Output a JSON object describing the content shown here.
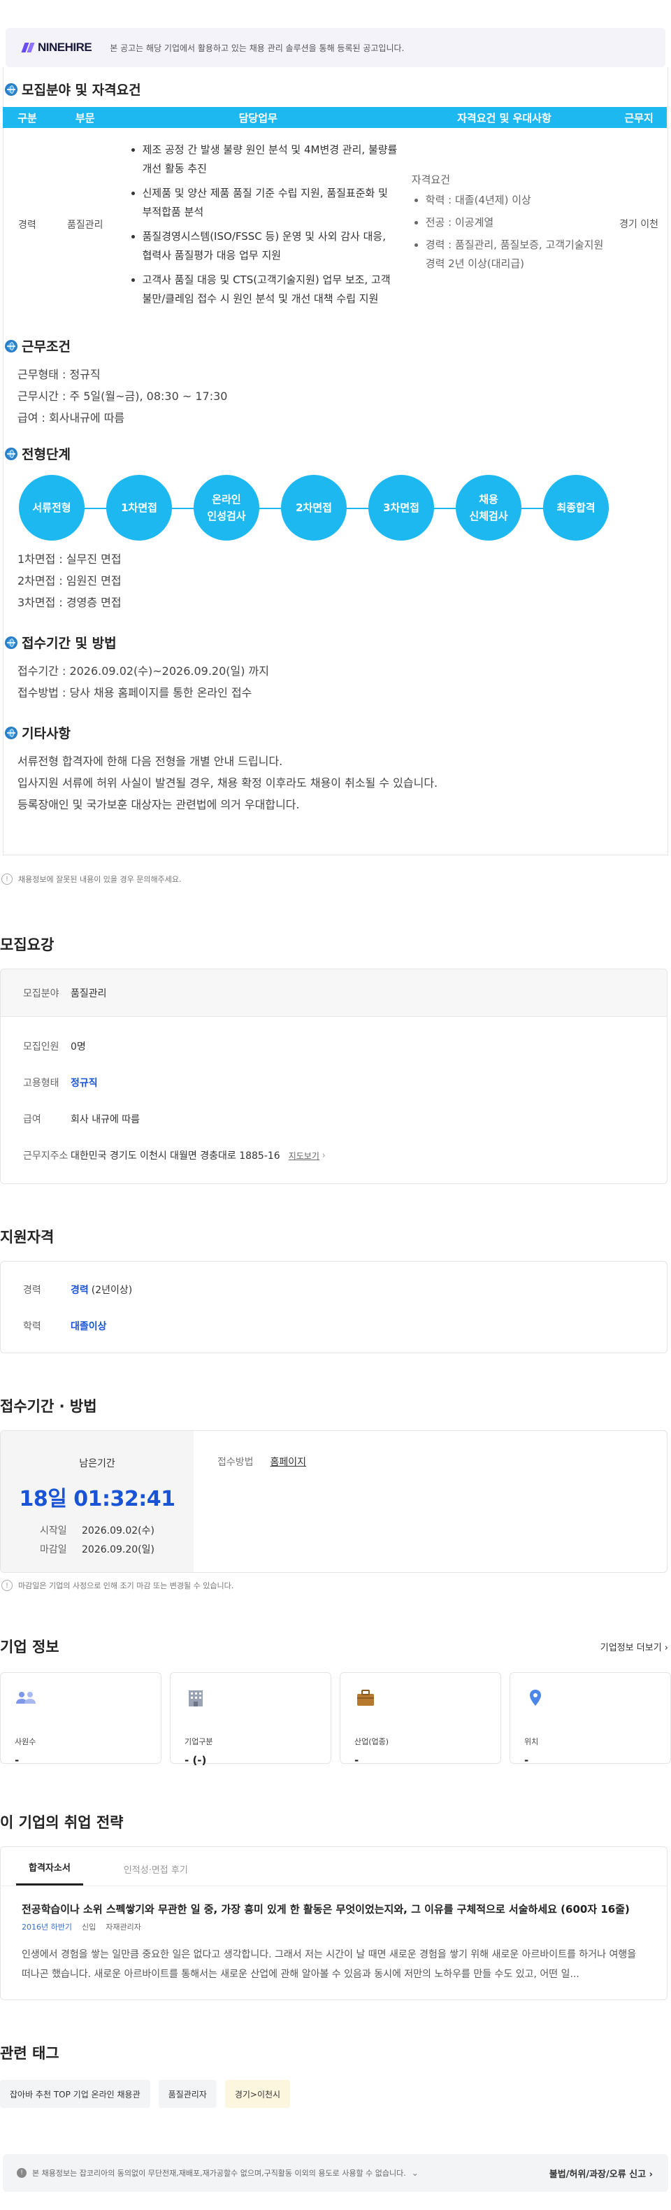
{
  "banner": {
    "logo": "NINEHIRE",
    "text": "본 공고는 해당 기업에서 활용하고 있는 채용 관리 솔루션을 통해 등록된 공고입니다."
  },
  "detail": {
    "field_title": "모집분야 및 자격요건",
    "table": {
      "headers": [
        "구분",
        "부문",
        "담당업무",
        "자격요건 및 우대사항",
        "근무지"
      ],
      "gubun": "경력",
      "bumun": "품질관리",
      "duties": [
        "제조 공정 간 발생 불량 원인 분석 및 4M변경 관리, 불량률 개선 활동 추진",
        "신제품 및 양산 제품 품질 기준 수립 지원, 품질표준화 및 부적합품 분석",
        "품질경영시스템(ISO/FSSC 등) 운영 및 사외 감사 대응, 협력사 품질평가 대응 업무 지원",
        "고객사 품질 대응 및 CTS(고객기술지원) 업무 보조, 고객 불만/클레임 접수 시 원인 분석 및 개선 대책 수립 지원"
      ],
      "qual_heading": "자격요건",
      "quals": [
        "학력 : 대졸(4년제) 이상",
        "전공 : 이공계열",
        "경력 : 품질관리, 품질보증, 고객기술지원 경력 2년 이상(대리급)"
      ],
      "work_place": "경기 이천"
    },
    "cond_title": "근무조건",
    "cond": [
      "근무형태 : 정규직",
      "근무시간 : 주 5일(월~금), 08:30 ~ 17:30",
      "급여 : 회사내규에 따름"
    ],
    "step_title": "전형단계",
    "steps": [
      "서류전형",
      "1차면접",
      "온라인\n인성검사",
      "2차면접",
      "3차면접",
      "채용\n신체검사",
      "최종합격"
    ],
    "step_desc": [
      "1차면접 : 실무진 면접",
      "2차면접 : 임원진 면접",
      "3차면접 : 경영층 면접"
    ],
    "period_title": "접수기간 및 방법",
    "period": [
      "접수기간 : 2026.09.02(수)~2026.09.20(일) 까지",
      "접수방법 : 당사 채용 홈페이지를 통한 온라인 접수"
    ],
    "etc_title": "기타사항",
    "etc": [
      "서류전형 합격자에 한해 다음 전형을 개별 안내 드립니다.",
      "입사지원 서류에 허위 사실이 발견될 경우, 채용 확정 이후라도 채용이 취소될 수 있습니다.",
      "등록장애인 및 국가보훈 대상자는 관련법에 의거 우대합니다."
    ]
  },
  "report_notice": "채용정보에 잘못된 내용이 있을 경우 문의해주세요.",
  "summary": {
    "title": "모집요강",
    "field_label": "모집분야",
    "field_value": "품질관리",
    "rows": [
      {
        "k": "모집인원",
        "v": "0명"
      },
      {
        "k": "고용형태",
        "v": "정규직"
      },
      {
        "k": "급여",
        "v": "회사 내규에 따름"
      },
      {
        "k": "근무지주소",
        "v": "대한민국 경기도 이천시 대월면 경충대로 1885-16"
      }
    ],
    "map_link": "지도보기"
  },
  "qualification": {
    "title": "지원자격",
    "career_label": "경력",
    "career_value": "경력",
    "career_extra": "(2년이상)",
    "edu_label": "학력",
    "edu_value": "대졸이상"
  },
  "apply": {
    "title": "접수기간 · 방법",
    "remain_label": "남은기간",
    "remain_value": "18일 01:32:41",
    "start_label": "시작일",
    "start_value": "2026.09.02(수)",
    "end_label": "마감일",
    "end_value": "2026.09.20(일)",
    "method_label": "접수방법",
    "method_value": "홈페이지",
    "notice": "마감일은 기업의 사정으로 인해 조기 마감 또는 변경될 수 있습니다."
  },
  "corp": {
    "title": "기업 정보",
    "more": "기업정보 더보기",
    "cards": [
      {
        "label": "사원수",
        "value": "-",
        "icon": "people-icon"
      },
      {
        "label": "기업구분",
        "value": "- (-)",
        "icon": "building-icon"
      },
      {
        "label": "산업(업종)",
        "value": "-",
        "icon": "briefcase-icon"
      },
      {
        "label": "위치",
        "value": "-",
        "icon": "location-pin-icon"
      }
    ]
  },
  "strategy": {
    "title": "이 기업의 취업 전략",
    "tabs": [
      "합격자소서",
      "인적성·면접 후기"
    ],
    "question": "전공학습이나 소위 스펙쌓기와 무관한 일 중, 가장 흥미 있게 한 활동은 무엇이었는지와, 그 이유를 구체적으로 서술하세요 (600자 16줄)",
    "meta1": "2016년 하반기",
    "meta2": "신입",
    "meta3": "자재관리자",
    "body": "인생에서 경험을 쌓는 일만큼 중요한 일은 없다고 생각합니다. 그래서 저는 시간이 날 때면 새로운 경험을 쌓기 위해 새로운 아르바이트를 하거나 여행을 떠나곤 했습니다. 새로운 아르바이트를 통해서는 새로운 산업에 관해 알아볼 수 있음과 동시에 저만의 노하우를 만들 수도 있고, 어떤 일..."
  },
  "tags": {
    "title": "관련 태그",
    "items": [
      "잡아바 추천 TOP 기업 온라인 채용관",
      "품질관리자",
      "경기>이천시"
    ]
  },
  "footer": {
    "notice": "본 채용정보는 잡코리아의 동의없이 무단전재,재배포,재가공할수 없으며,구직활동 이외의 용도로 사용할 수 없습니다.",
    "report": "불법/허위/과장/오류 신고"
  }
}
